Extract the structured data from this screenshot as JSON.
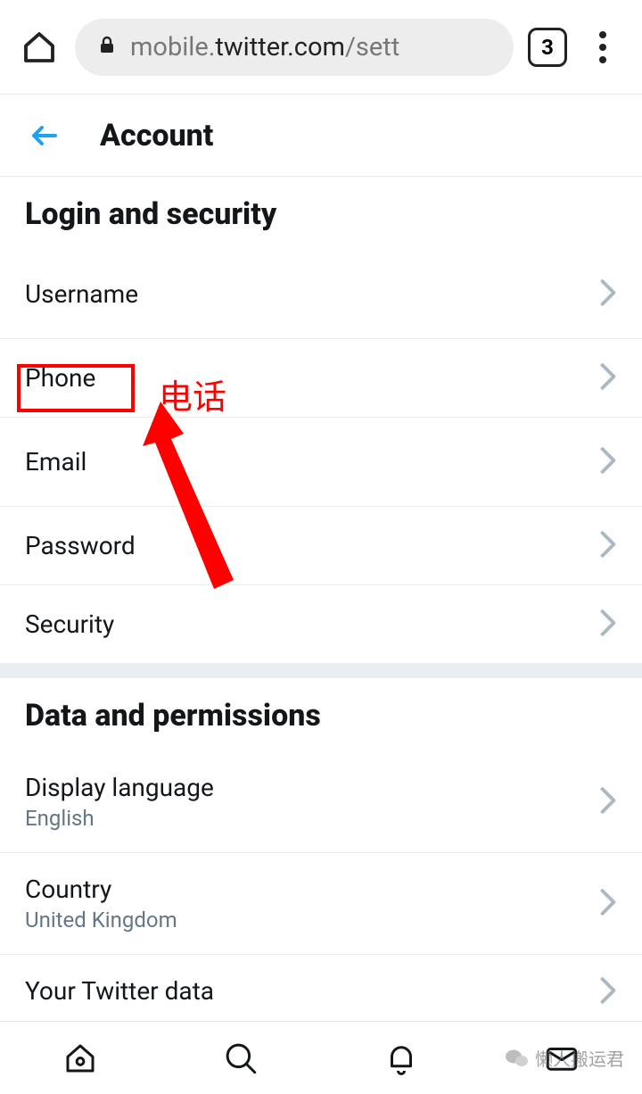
{
  "browser": {
    "url_host_prefix": "mobile.",
    "url_host": "twitter.com",
    "url_path": "/sett",
    "tab_count": "3"
  },
  "header": {
    "title": "Account"
  },
  "sections": [
    {
      "title": "Login and security",
      "items": [
        {
          "label": "Username"
        },
        {
          "label": "Phone"
        },
        {
          "label": "Email"
        },
        {
          "label": "Password"
        },
        {
          "label": "Security"
        }
      ]
    },
    {
      "title": "Data and permissions",
      "items": [
        {
          "label": "Display language",
          "sublabel": "English"
        },
        {
          "label": "Country",
          "sublabel": "United Kingdom"
        },
        {
          "label": "Your Twitter data"
        }
      ]
    }
  ],
  "annotation": {
    "label": "电话"
  },
  "watermark": {
    "text": "懒人搬运君"
  }
}
